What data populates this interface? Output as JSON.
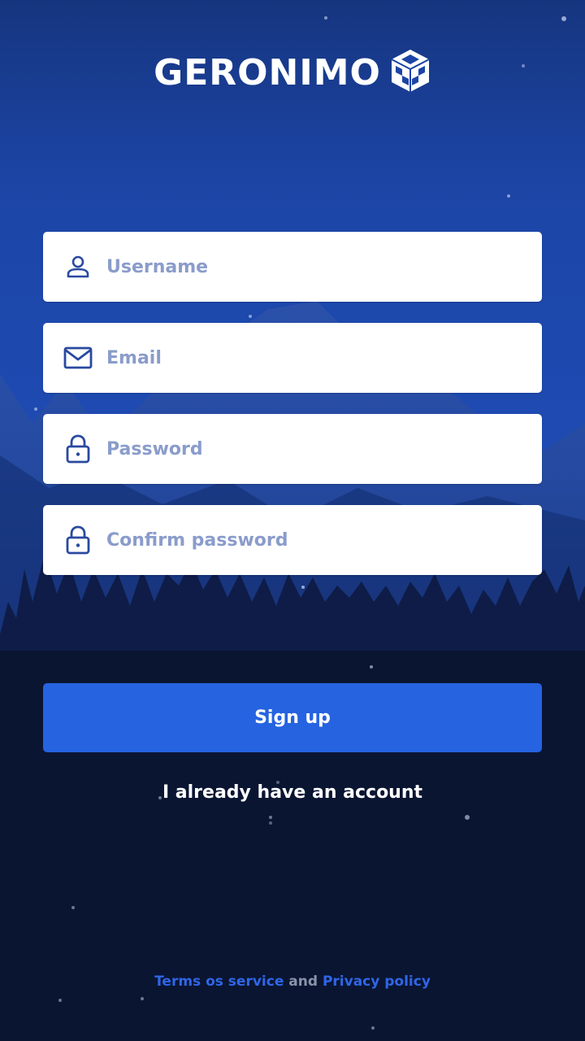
{
  "app": {
    "brand": "GERONIMO",
    "logo_icon": "cube-icon"
  },
  "form": {
    "username": {
      "placeholder": "Username",
      "icon": "user-icon"
    },
    "email": {
      "placeholder": "Email",
      "icon": "mail-icon"
    },
    "password": {
      "placeholder": "Password",
      "icon": "lock-icon"
    },
    "confirm_password": {
      "placeholder": "Confirm password",
      "icon": "lock-icon"
    }
  },
  "actions": {
    "signup_label": "Sign up",
    "login_link": "I already have an account"
  },
  "footer": {
    "terms_label": "Terms os service",
    "conjunction": "and",
    "privacy_label": "Privacy policy"
  },
  "colors": {
    "primary": "#2563e0",
    "link": "#2f66e6",
    "placeholder": "#8a9ccb",
    "icon": "#2a4aa0",
    "sky_top": "#1a3d9c",
    "night": "#0b1533"
  }
}
